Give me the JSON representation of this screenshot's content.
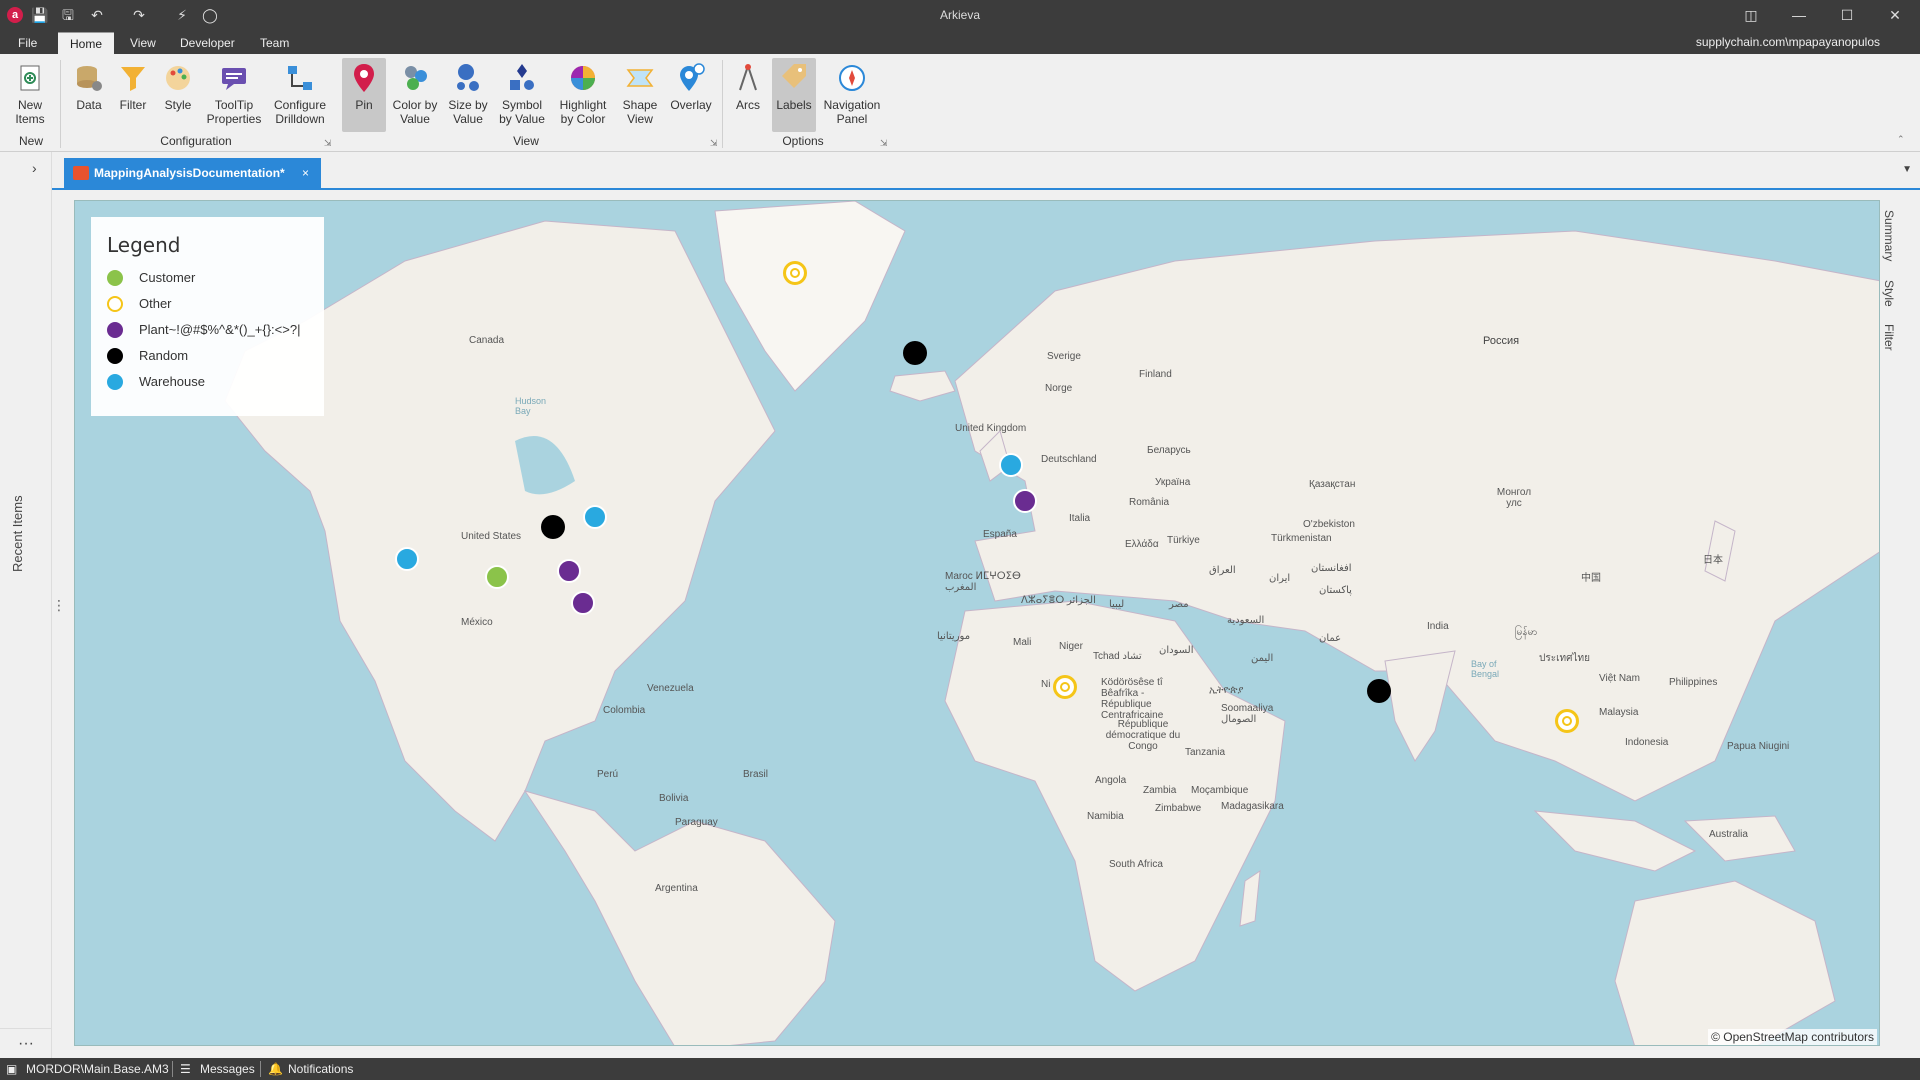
{
  "window": {
    "title": "Arkieva",
    "app_icon": "a"
  },
  "menu": {
    "tabs": [
      "File",
      "Home",
      "View",
      "Developer",
      "Team"
    ],
    "active_tab": "Home",
    "account": "supplychain.com\\mpapayanopulos"
  },
  "ribbon": {
    "new_items": "New Items",
    "data": "Data",
    "filter": "Filter",
    "style": "Style",
    "tooltip": "ToolTip Properties",
    "drilldown": "Configure Drilldown",
    "pin": "Pin",
    "color_by_value": "Color by Value",
    "size_by_value": "Size by Value",
    "symbol_by_value": "Symbol by Value",
    "highlight_by_color": "Highlight by Color",
    "shape_view": "Shape View",
    "overlay": "Overlay",
    "arcs": "Arcs",
    "labels": "Labels",
    "navigation_panel": "Navigation Panel",
    "groups": {
      "new": "New",
      "configuration": "Configuration",
      "view": "View",
      "options": "Options"
    }
  },
  "left_rail": {
    "recent_items": "Recent Items",
    "more": "···"
  },
  "doc_tab": {
    "label": "MappingAnalysisDocumentation*",
    "close": "×"
  },
  "right_rail": {
    "summary": "Summary",
    "style": "Style",
    "filter": "Filter"
  },
  "legend": {
    "title": "Legend",
    "items": [
      {
        "label": "Customer",
        "color": "#8bc34a"
      },
      {
        "label": "Other",
        "color": "#f5c518"
      },
      {
        "label": "Plant~!@#$%^&*()_+{}:<>?|",
        "color": "#6a2c91"
      },
      {
        "label": "Random",
        "color": "#000000"
      },
      {
        "label": "Warehouse",
        "color": "#29a9e0"
      }
    ]
  },
  "map": {
    "attribution": "© OpenStreetMap contributors",
    "labels": {
      "canada": "Canada",
      "usa": "United States",
      "mexico": "México",
      "venezuela": "Venezuela",
      "colombia": "Colombia",
      "peru": "Perú",
      "brasil": "Brasil",
      "bolivia": "Bolivia",
      "paraguay": "Paraguay",
      "argentina": "Argentina",
      "hudson": "Hudson Bay",
      "uk": "United Kingdom",
      "sverige": "Sverige",
      "norge": "Norge",
      "finland": "Finland",
      "deutschland": "Deutschland",
      "belarus": "Беларусь",
      "ukraine": "Україна",
      "romania": "România",
      "italia": "Italia",
      "espana": "España",
      "turkiye": "Türkiye",
      "ellada": "Ελλάδα",
      "rossiya": "Россия",
      "kazakhstan": "Қазақстан",
      "mongol": "Монгол улс",
      "uzbekistan": "O'zbekiston",
      "turkmenistan": "Türkmenistan",
      "afghanistan": "افغانستان",
      "pakistan": "پاکستان",
      "iran": "ایران",
      "iraq": "العراق",
      "saudi": "السعودية",
      "yemen": "اليمن",
      "oman": "عمان",
      "india": "India",
      "china": "中国",
      "japan": "日本",
      "morocco": "Maroc ⵍⵎⵖⵔⵉⴱ المغرب",
      "algeria": "ⴷⵣⴰⵢⴻⵔ الجزائر",
      "libya": "ليبيا",
      "egypt": "مصر",
      "mali": "Mali",
      "mauritania": "موريتانيا",
      "niger": "Niger",
      "chad": "Tchad تشاد",
      "sudan": "السودان",
      "ethiopia": "ኢትዮጵያ",
      "somalia": "Soomaaliya الصومال",
      "nigeria": "Ni",
      "car": "Ködörösêse tî Bêafrîka - République Centrafricaine",
      "drc": "République démocratique du Congo",
      "tanzania": "Tanzania",
      "angola": "Angola",
      "zambia": "Zambia",
      "mozambique": "Moçambique",
      "namibia": "Namibia",
      "zimbabwe": "Zimbabwe",
      "madagascar": "Madagasikara",
      "south_africa": "South Africa",
      "myanmar": "မြန်မာ",
      "thailand": "ประเทศไทย",
      "vietnam": "Việt Nam",
      "philippines": "Philippines",
      "malaysia": "Malaysia",
      "indonesia": "Indonesia",
      "png": "Papua Niugini",
      "australia": "Australia",
      "bay_bengal": "Bay of Bengal"
    }
  },
  "statusbar": {
    "path": "MORDOR\\Main.Base.AM3",
    "messages": "Messages",
    "notifications": "Notifications"
  }
}
